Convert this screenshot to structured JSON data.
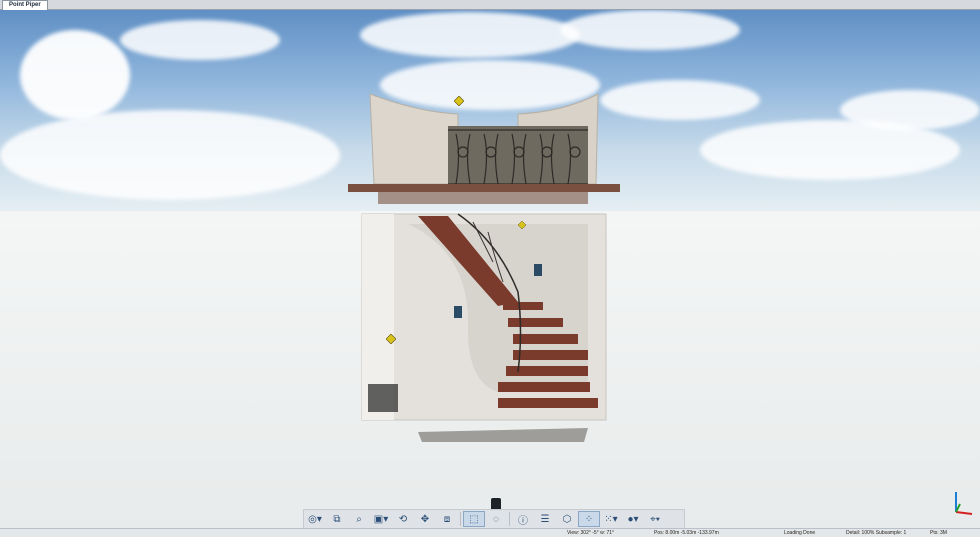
{
  "tabs": [
    {
      "label": "Point Piper"
    }
  ],
  "toolbar": {
    "buttons": [
      {
        "name": "orbit-icon",
        "glyph": "◎▾"
      },
      {
        "name": "frame-icon",
        "glyph": "⧉"
      },
      {
        "name": "zoom-icon",
        "glyph": "⌕"
      },
      {
        "name": "view-cube-icon",
        "glyph": "▣▾"
      },
      {
        "name": "rotate-icon",
        "glyph": "⟲"
      },
      {
        "name": "walk-icon",
        "glyph": "✥"
      },
      {
        "name": "multi-view-icon",
        "glyph": "⧈"
      },
      {
        "name": "scan-view-icon",
        "glyph": "⬚"
      },
      {
        "name": "lasso-icon",
        "glyph": "◌"
      },
      {
        "name": "info-icon",
        "glyph": "ⓘ"
      },
      {
        "name": "list-icon",
        "glyph": "☰"
      },
      {
        "name": "clip-box-icon",
        "glyph": "⬡"
      },
      {
        "name": "points-icon",
        "glyph": "⁘"
      },
      {
        "name": "point-size-icon",
        "glyph": "⁙▾"
      },
      {
        "name": "color-mode-icon",
        "glyph": "●▾"
      },
      {
        "name": "measure-icon",
        "glyph": "⌖▾"
      }
    ]
  },
  "status": {
    "view": "View: 302° -5° w: 71°",
    "pos": "Pos: 8.00m -5.03m -133.97m",
    "loading": "Loading Done",
    "detail": "Detail: 100%  Subsample:  1",
    "pts": "Pts:  3M"
  },
  "colors": {
    "accent": "#2c4f78",
    "sky": "#8fb5dc",
    "ground": "#eceeee"
  }
}
